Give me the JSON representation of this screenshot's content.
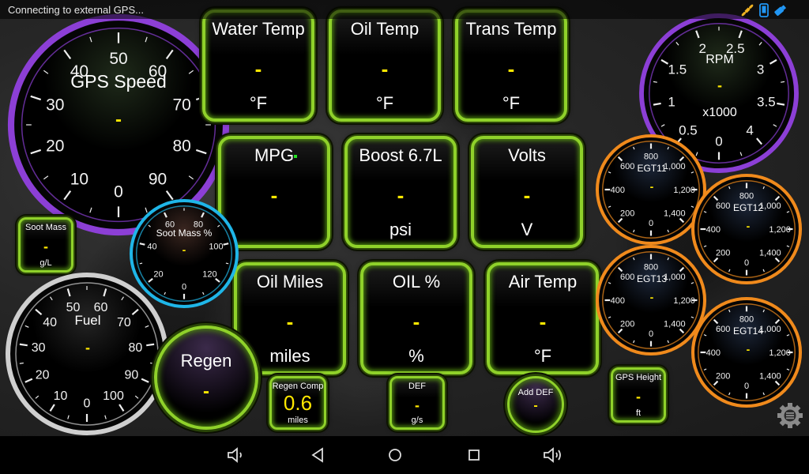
{
  "status_bar": {
    "message": "Connecting to external GPS...",
    "icons": [
      "gps-satellite-icon",
      "phone-icon",
      "usb-adapter-icon"
    ],
    "colors": {
      "gps": "#f0b323",
      "phone": "#2196f3",
      "adapter": "#2196f3"
    }
  },
  "colors": {
    "accent_green": "#8fd12a",
    "value_yellow": "#ffe800",
    "purple_ring": "#8c3fd6",
    "cyan_ring": "#1fb6e8",
    "orange_ring": "#f08a1c",
    "silver_ring": "#cfcfcf"
  },
  "dials": {
    "gps_speed": {
      "title": "GPS Speed",
      "value": "-",
      "ticks": [
        "0",
        "10",
        "20",
        "30",
        "40",
        "50",
        "60",
        "70",
        "80",
        "90"
      ]
    },
    "rpm": {
      "title": "RPM",
      "subtitle": "x1000",
      "value": "-",
      "ticks": [
        "0",
        "0.5",
        "1",
        "1.5",
        "2",
        "2.5",
        "3",
        "3.5",
        "4"
      ]
    },
    "soot_mass_pct": {
      "title": "Soot Mass %",
      "value": "-",
      "ticks": [
        "0",
        "20",
        "40",
        "60",
        "80",
        "100",
        "120"
      ]
    },
    "fuel": {
      "title": "Fuel",
      "value": "-",
      "ticks": [
        "0",
        "10",
        "20",
        "30",
        "40",
        "50",
        "60",
        "70",
        "80",
        "90",
        "100"
      ]
    },
    "egt11": {
      "title": "EGT11",
      "value": "-",
      "ticks": [
        "0",
        "200",
        "400",
        "600",
        "800",
        "1,000",
        "1,200",
        "1,400"
      ]
    },
    "egt12": {
      "title": "EGT12",
      "value": "-",
      "ticks": [
        "0",
        "200",
        "400",
        "600",
        "800",
        "1,000",
        "1,200",
        "1,400"
      ]
    },
    "egt13": {
      "title": "EGT13",
      "value": "-",
      "ticks": [
        "0",
        "200",
        "400",
        "600",
        "800",
        "1,000",
        "1,200",
        "1,400"
      ]
    },
    "egt14": {
      "title": "EGT14",
      "value": "-",
      "ticks": [
        "0",
        "200",
        "400",
        "600",
        "800",
        "1,000",
        "1,200",
        "1,400"
      ]
    }
  },
  "tiles": {
    "water_temp": {
      "title": "Water Temp",
      "value": "-",
      "unit": "°F"
    },
    "oil_temp": {
      "title": "Oil Temp",
      "value": "-",
      "unit": "°F"
    },
    "trans_temp": {
      "title": "Trans Temp",
      "value": "-",
      "unit": "°F"
    },
    "mpg": {
      "title": "MPG",
      "value": "-",
      "unit": ""
    },
    "boost": {
      "title": "Boost 6.7L",
      "value": "-",
      "unit": "psi"
    },
    "volts": {
      "title": "Volts",
      "value": "-",
      "unit": "V"
    },
    "oil_miles": {
      "title": "Oil Miles",
      "value": "-",
      "unit": "miles"
    },
    "oil_pct": {
      "title": "OIL %",
      "value": "-",
      "unit": "%"
    },
    "air_temp": {
      "title": "Air Temp",
      "value": "-",
      "unit": "°F"
    },
    "soot_mass": {
      "title": "Soot Mass",
      "value": "-",
      "unit": "g/L"
    },
    "regen_comp": {
      "title": "Regen Comp",
      "value": "0.6",
      "unit": "miles"
    },
    "def": {
      "title": "DEF",
      "value": "-",
      "unit": "g/s"
    },
    "gps_height": {
      "title": "GPS Height",
      "value": "-",
      "unit": "ft"
    }
  },
  "round_tiles": {
    "regen": {
      "title": "Regen",
      "value": "-"
    },
    "add_def": {
      "title": "Add DEF",
      "value": "-"
    }
  },
  "nav_bar": {
    "buttons": [
      "volume-down",
      "back",
      "home",
      "recents",
      "volume-up"
    ]
  }
}
